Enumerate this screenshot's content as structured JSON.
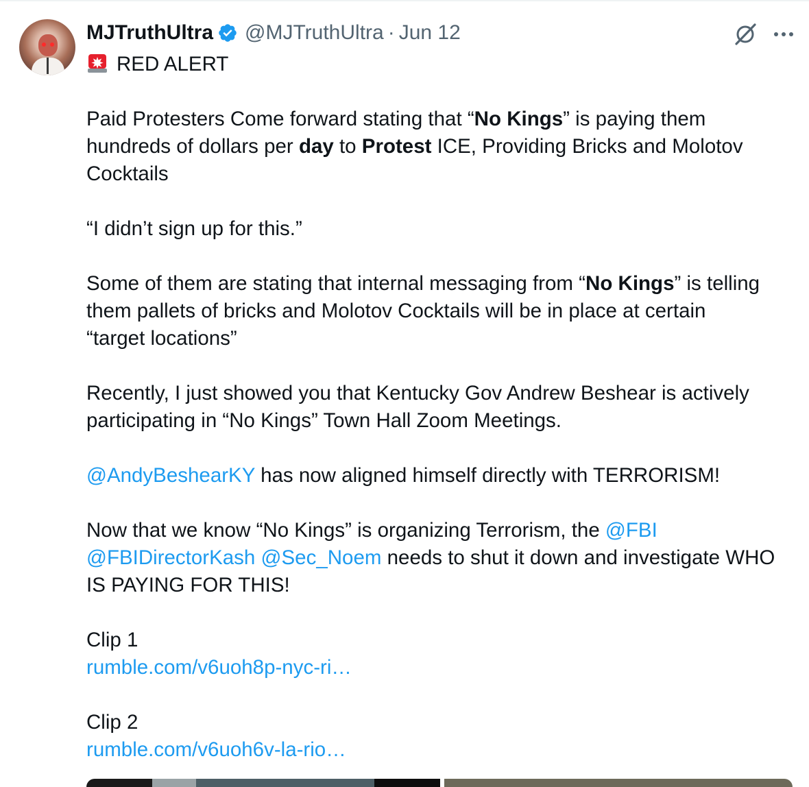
{
  "post": {
    "author_name": "MJTruthUltra",
    "handle": "@MJTruthUltra",
    "separator": "·",
    "date": "Jun 12",
    "icons": {
      "verified": "verified-badge-icon",
      "grok": "grok-icon",
      "more": "more-options-icon",
      "alert": "police-light-emoji"
    },
    "colors": {
      "link": "#1d9bf0",
      "secondary": "#536471",
      "verified": "#1d9bf0"
    },
    "text": {
      "alert_label": "RED ALERT",
      "p1_a": "Paid Protesters Come forward stating that “",
      "p1_b": "No Kings",
      "p1_c": "” is paying them",
      "p1_d": "hundreds of dollars per ",
      "p1_e": "day",
      "p1_f": " to ",
      "p1_g": "Protest",
      "p1_h": " ICE, Providing Bricks and Molotov",
      "p1_i": "Cocktails",
      "quote": "“I didn’t sign up for this.”",
      "p3_a": "Some of them are stating that internal messaging from “",
      "p3_b": "No Kings",
      "p3_c": "” is telling",
      "p3_d": "them pallets of bricks and Molotov Cocktails will be in place at certain",
      "p3_e": "“target locations”",
      "p4_a": "Recently, I just showed you that Kentucky Gov Andrew Beshear is actively",
      "p4_b": "participating in “No Kings” Town Hall Zoom Meetings.",
      "mention_andy": "@AndyBeshearKY",
      "p5_rest": " has now aligned himself directly with TERRORISM!",
      "p6_a": "Now that we know “No Kings” is organizing Terrorism, the ",
      "mention_fbi": "@FBI",
      "mention_kash": "@FBIDirectorKash",
      "space": " ",
      "mention_noem": "@Sec_Noem",
      "p6_b": " needs to shut it down and investigate WHO",
      "p6_c": "IS PAYING FOR THIS!",
      "clip1_label": "Clip 1",
      "clip1_link": "rumble.com/v6uoh8p-nyc-ri…",
      "clip2_label": "Clip 2",
      "clip2_link": "rumble.com/v6uoh6v-la-rio…"
    }
  }
}
